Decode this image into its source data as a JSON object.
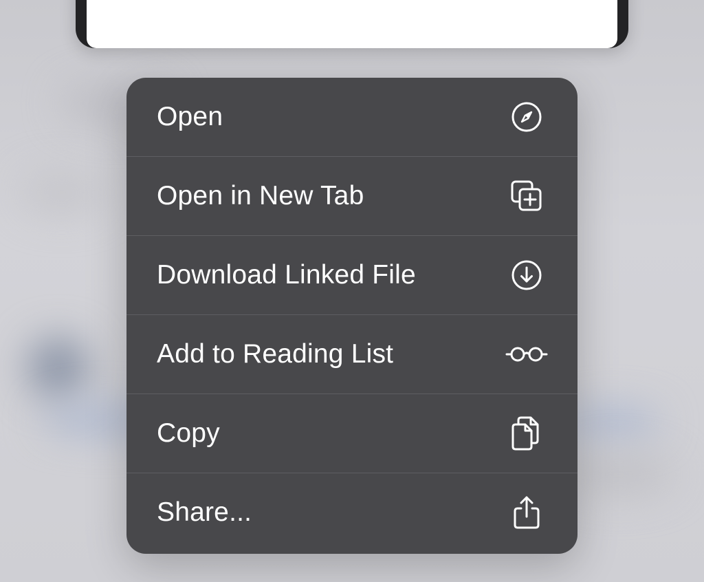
{
  "menu": {
    "items": [
      {
        "label": "Open",
        "icon": "compass-icon"
      },
      {
        "label": "Open in New Tab",
        "icon": "new-tab-icon"
      },
      {
        "label": "Download Linked File",
        "icon": "download-icon"
      },
      {
        "label": "Add to Reading List",
        "icon": "glasses-icon"
      },
      {
        "label": "Copy",
        "icon": "copy-icon"
      },
      {
        "label": "Share...",
        "icon": "share-icon"
      }
    ]
  },
  "colors": {
    "menu_background": "#48484b",
    "separator": "#5e5e62",
    "text": "#ffffff",
    "backdrop": "#cfcfd4"
  }
}
